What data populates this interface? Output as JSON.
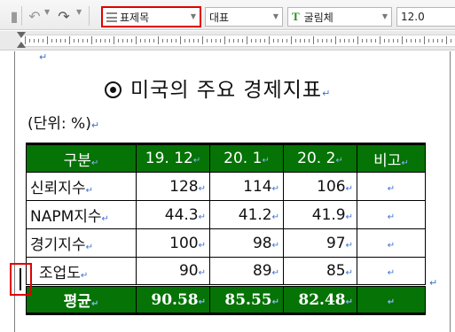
{
  "toolbar": {
    "undo_icon": "undo-icon",
    "redo_icon": "redo-icon",
    "style": {
      "value": "표제목",
      "icon": "paragraph-style-icon"
    },
    "language": {
      "value": "대표"
    },
    "font": {
      "icon_glyph": "T",
      "value": "굴림체"
    },
    "size": {
      "value": "12.0"
    }
  },
  "document": {
    "paragraph_mark": "↵",
    "title_bullet": "◉",
    "title": "미국의 주요 경제지표",
    "unit": "(단위: %)"
  },
  "table": {
    "headers": [
      "구분",
      "19. 12",
      "20. 1",
      "20. 2",
      "비고"
    ],
    "rows": [
      [
        "신뢰지수",
        "128",
        "114",
        "106",
        ""
      ],
      [
        "NAPM지수",
        "44.3",
        "41.2",
        "41.9",
        ""
      ],
      [
        "경기지수",
        "100",
        "98",
        "97",
        ""
      ],
      [
        "조업도",
        "90",
        "89",
        "85",
        ""
      ]
    ],
    "average": [
      "평균",
      "90.58",
      "85.55",
      "82.48",
      ""
    ]
  },
  "colors": {
    "table_header_bg": "#057305",
    "highlight_border": "#e00000",
    "paragraph_mark": "#3d6fd1"
  }
}
